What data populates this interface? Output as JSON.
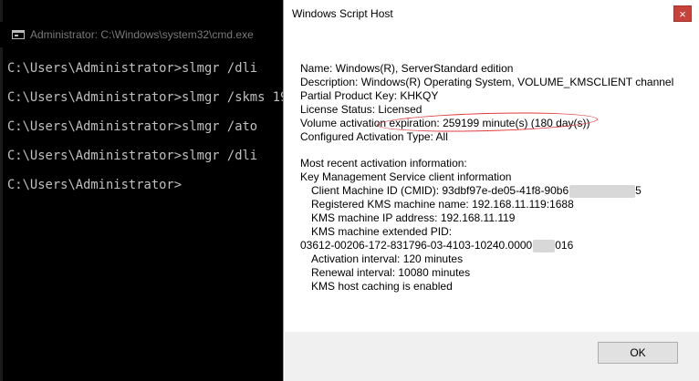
{
  "cmd": {
    "title": "Administrator: C:\\Windows\\system32\\cmd.exe",
    "lines": [
      "C:\\Users\\Administrator>slmgr /dli",
      "C:\\Users\\Administrator>slmgr /skms 19",
      "C:\\Users\\Administrator>slmgr /ato",
      "C:\\Users\\Administrator>slmgr /dli",
      "C:\\Users\\Administrator>"
    ]
  },
  "dialog": {
    "title": "Windows Script Host",
    "close_glyph": "×",
    "lines": {
      "name": "Name: Windows(R), ServerStandard edition",
      "description": "Description: Windows(R) Operating System, VOLUME_KMSCLIENT channel",
      "partial_key": "Partial Product Key: KHKQY",
      "license_status": "License Status: Licensed",
      "activation_expiration": "Volume activation expiration: 259199 minute(s) (180 day(s))",
      "activation_type": "Configured Activation Type: All",
      "recent_info": "Most recent activation information:",
      "kms_client_info": "Key Management Service client information",
      "cmid_prefix": "Client Machine ID (CMID): 93dbf97e-de05-41f8-90b6",
      "cmid_suffix": "5",
      "kms_name": "Registered KMS machine name: 192.168.11.119:1688",
      "kms_ip": "KMS machine IP address: 192.168.11.119",
      "kms_pid_label": "KMS machine extended PID:",
      "kms_pid_prefix": "03612-00206-172-831796-03-4103-10240.0000",
      "kms_pid_suffix": "016",
      "activation_interval": "Activation interval: 120 minutes",
      "renewal_interval": "Renewal interval: 10080 minutes",
      "host_caching": "KMS host caching is enabled"
    },
    "ok_label": "OK"
  }
}
